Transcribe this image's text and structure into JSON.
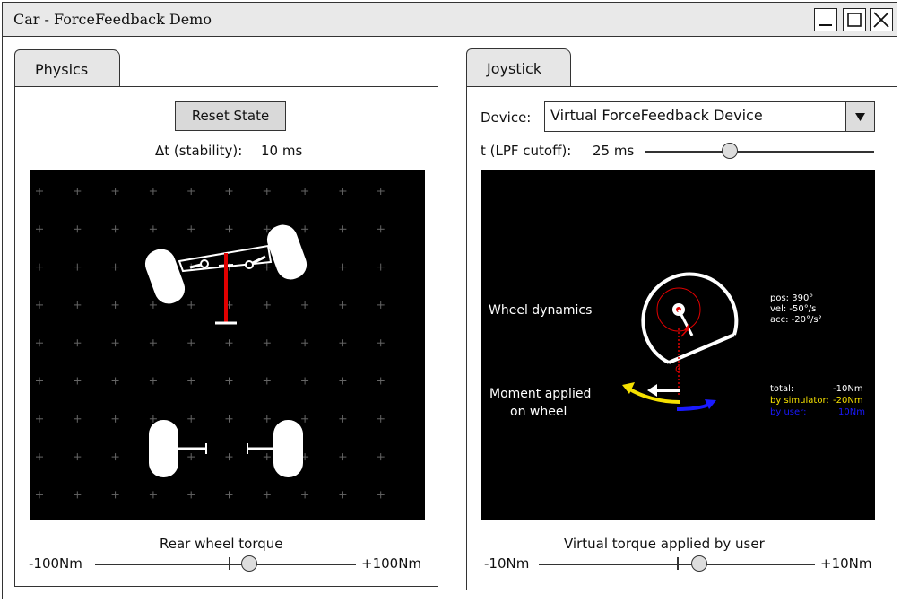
{
  "window": {
    "title": "Car - ForceFeedback Demo"
  },
  "physics": {
    "tab_label": "Physics",
    "reset_label": "Reset State",
    "stability_label": "Δt (stability):",
    "stability_value": "10 ms",
    "torque_label": "Rear wheel torque",
    "torque_min": "-100Nm",
    "torque_max": "+100Nm",
    "torque_fraction": 0.59
  },
  "joystick": {
    "tab_label": "Joystick",
    "device_label": "Device:",
    "device_value": "Virtual ForceFeedback Device",
    "lpf_label": "t (LPF cutoff):",
    "lpf_value": "25 ms",
    "lpf_fraction": 0.37,
    "wheel_dynamics_label": "Wheel dynamics",
    "moment_label_1": "Moment applied",
    "moment_label_2": "on wheel",
    "zero_mark": "0",
    "pos": "pos: 390°",
    "vel": "vel:   -50°/s",
    "acc": "acc:  -20°/s²",
    "total_label": "total:",
    "total_value": "-10Nm",
    "sim_label": "by simulator:",
    "sim_value": "-20Nm",
    "user_label": "by user:",
    "user_value": "10Nm",
    "user_torque_label": "Virtual torque applied by user",
    "user_torque_min": "-10Nm",
    "user_torque_max": "+10Nm",
    "user_torque_fraction": 0.58
  },
  "colors": {
    "simulator": "#f5e000",
    "user": "#1a1aff",
    "steer": "#e00000"
  }
}
